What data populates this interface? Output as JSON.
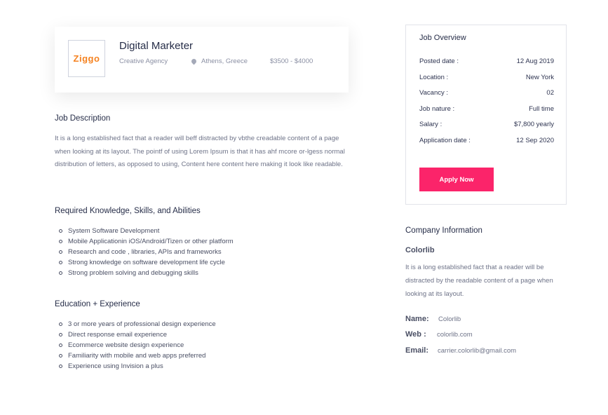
{
  "job": {
    "logo_text": "Ziggo",
    "title": "Digital Marketer",
    "company": "Creative Agency",
    "location": "Athens, Greece",
    "salary": "$3500 - $4000"
  },
  "description": {
    "heading": "Job Description",
    "text": "It is a long established fact that a reader will beff distracted by vbthe creadable content of a page when looking at its layout. The pointf of using Lorem Ipsum is that it has ahf mcore or-lgess normal distribution of letters, as opposed to using, Content here content here making it look like readable."
  },
  "knowledge": {
    "heading": "Required Knowledge, Skills, and Abilities",
    "items": [
      "System Software Development",
      "Mobile Applicationin iOS/Android/Tizen or other platform",
      "Research and code , libraries, APIs and frameworks",
      "Strong knowledge on software development life cycle",
      "Strong problem solving and debugging skills"
    ]
  },
  "education": {
    "heading": "Education + Experience",
    "items": [
      "3 or more years of professional design experience",
      "Direct response email experience",
      "Ecommerce website design experience",
      "Familiarity with mobile and web apps preferred",
      "Experience using Invision a plus"
    ]
  },
  "overview": {
    "heading": "Job Overview",
    "rows": [
      {
        "label": "Posted date :",
        "value": "12 Aug 2019"
      },
      {
        "label": "Location :",
        "value": "New York"
      },
      {
        "label": "Vacancy :",
        "value": "02"
      },
      {
        "label": "Job nature :",
        "value": "Full time"
      },
      {
        "label": "Salary :",
        "value": "$7,800 yearly"
      },
      {
        "label": "Application date :",
        "value": "12 Sep 2020"
      }
    ],
    "apply_label": "Apply Now"
  },
  "company": {
    "heading": "Company Information",
    "name": "Colorlib",
    "description": "It is a long established fact that a reader will be distracted by the readable content of a page when looking at its layout.",
    "contact": [
      {
        "label": "Name:",
        "value": "Colorlib"
      },
      {
        "label": "Web :",
        "value": "colorlib.com"
      },
      {
        "label": "Email:",
        "value": "carrier.colorlib@gmail.com"
      }
    ]
  },
  "colors": {
    "accent": "#fb246a",
    "logo": "#f58220"
  }
}
